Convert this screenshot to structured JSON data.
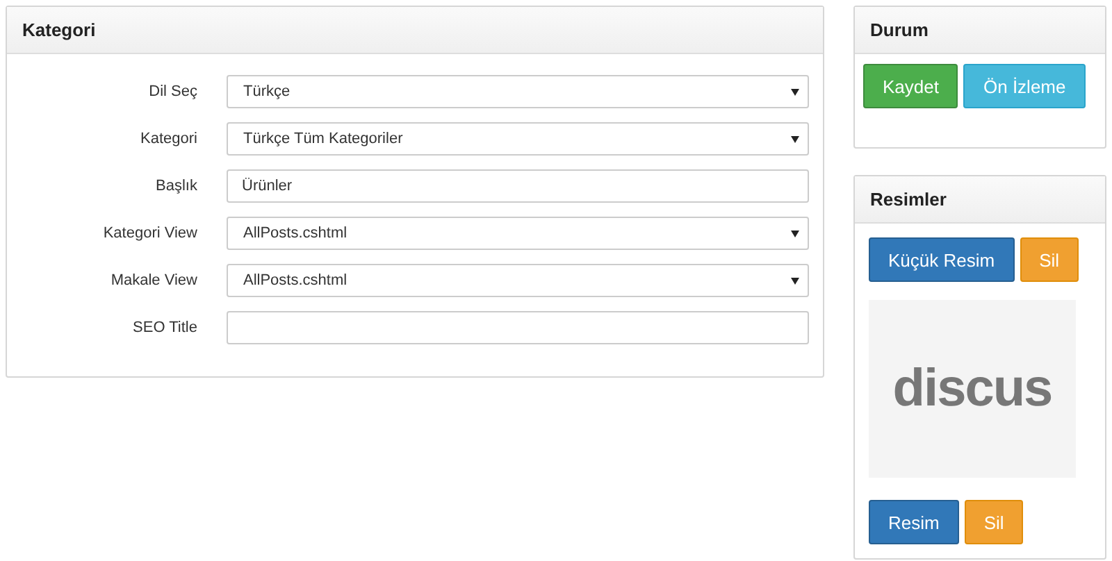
{
  "category_panel": {
    "title": "Kategori",
    "fields": [
      {
        "label": "Dil Seç",
        "kind": "select",
        "value": "Türkçe"
      },
      {
        "label": "Kategori",
        "kind": "select",
        "value": "Türkçe Tüm Kategoriler"
      },
      {
        "label": "Başlık",
        "kind": "text",
        "value": "Ürünler"
      },
      {
        "label": "Kategori View",
        "kind": "select",
        "value": "AllPosts.cshtml"
      },
      {
        "label": "Makale View",
        "kind": "select",
        "value": "AllPosts.cshtml"
      },
      {
        "label": "SEO Title",
        "kind": "text"
      }
    ]
  },
  "status_panel": {
    "title": "Durum",
    "buttons": [
      {
        "label": "Kaydet",
        "kind": "success"
      },
      {
        "label": "Ön İzleme",
        "kind": "info"
      }
    ]
  },
  "images_panel": {
    "title": "Resimler",
    "thumbnail_buttons": [
      {
        "label": "Küçük Resim",
        "kind": "primary"
      },
      {
        "label": "Sil",
        "kind": "warning"
      }
    ],
    "preview": {
      "logo_text": "discus"
    },
    "image_buttons": [
      {
        "label": "Resim",
        "kind": "primary"
      },
      {
        "label": "Sil",
        "kind": "warning"
      }
    ]
  }
}
